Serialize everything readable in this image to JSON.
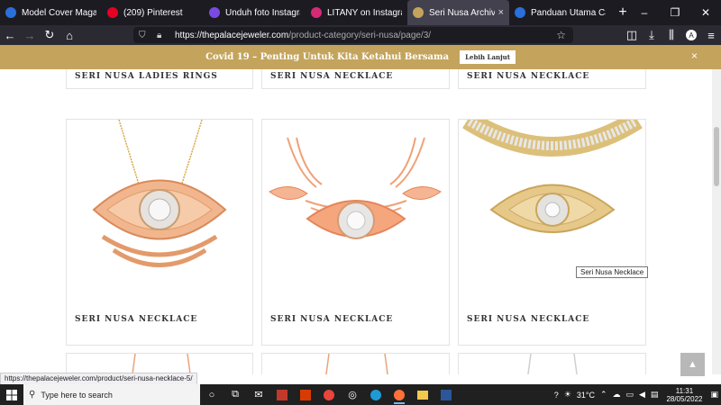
{
  "tabs": [
    {
      "title": "Model Cover Magazine - Po",
      "icon": "canva-icon",
      "color": "#2a6fdb"
    },
    {
      "title": "(209) Pinterest",
      "icon": "pinterest-icon",
      "color": "#e60023"
    },
    {
      "title": "Unduh foto Instagram onlin",
      "icon": "downloader-icon",
      "color": "#7b4ae2"
    },
    {
      "title": "LITANY on Instagram: \"LITA",
      "icon": "instagram-icon",
      "color": "#d62976"
    },
    {
      "title": "Seri Nusa Archives - Page",
      "icon": "palace-icon",
      "color": "#c4a45c",
      "active": true
    },
    {
      "title": "Panduan Utama Canva untu",
      "icon": "canva-icon",
      "color": "#2a6fdb"
    }
  ],
  "url": {
    "host": "https://thepalacejeweler.com",
    "path": "/product-category/seri-nusa/page/3/"
  },
  "banner": {
    "text": "Covid 19 – Penting Untuk Kita Ketahui Bersama",
    "button": "Lebih Lanjut",
    "close": "×"
  },
  "products_top": [
    "SERI NUSA LADIES RINGS",
    "SERI NUSA NECKLACE",
    "SERI NUSA NECKLACE"
  ],
  "products_mid": [
    "SERI NUSA NECKLACE",
    "SERI NUSA NECKLACE",
    "SERI NUSA NECKLACE"
  ],
  "tooltip": "Seri Nusa Necklace",
  "status_url": "https://thepalacejeweler.com/product/seri-nusa-necklace-5/",
  "taskbar": {
    "search_placeholder": "Type here to search",
    "weather": "31°C",
    "time": "11:31",
    "date": "28/05/2022"
  },
  "colors": {
    "gold": "#c4a45c",
    "rose": "#e8956b"
  }
}
